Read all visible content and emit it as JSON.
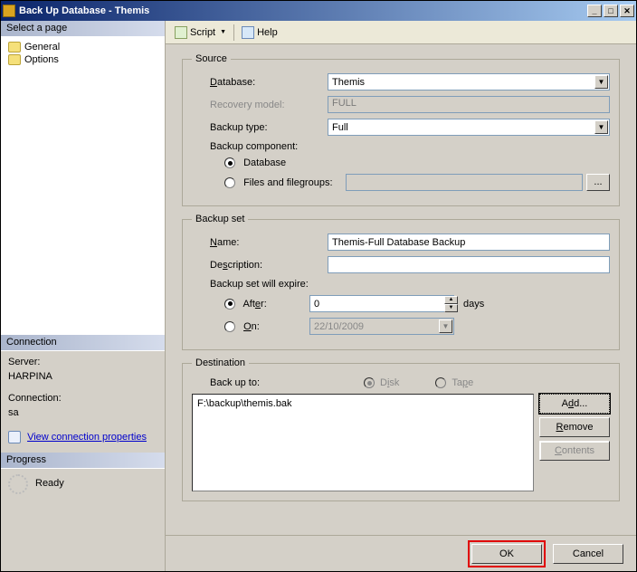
{
  "title": "Back Up Database - Themis",
  "leftpane": {
    "select_page_hdr": "Select a page",
    "nav": [
      "General",
      "Options"
    ],
    "connection_hdr": "Connection",
    "server_label": "Server:",
    "server_value": "HARPINA",
    "connection_label": "Connection:",
    "connection_value": "sa",
    "view_props": "View connection properties",
    "progress_hdr": "Progress",
    "progress_text": "Ready"
  },
  "toolbar": {
    "script": "Script",
    "help": "Help"
  },
  "source": {
    "legend": "Source",
    "database_label": "Database:",
    "database_value": "Themis",
    "recovery_label": "Recovery model:",
    "recovery_value": "FULL",
    "backuptype_label": "Backup type:",
    "backuptype_value": "Full",
    "component_label": "Backup component:",
    "opt_database": "Database",
    "opt_files": "Files and filegroups:",
    "files_btn": "..."
  },
  "backupset": {
    "legend": "Backup set",
    "name_label": "Name:",
    "name_value": "Themis-Full Database Backup",
    "desc_label": "Description:",
    "desc_value": "",
    "expire_label": "Backup set will expire:",
    "after_label": "After:",
    "after_value": "0",
    "after_unit": "days",
    "on_label": "On:",
    "on_value": "22/10/2009"
  },
  "dest": {
    "legend": "Destination",
    "backup_to": "Back up to:",
    "opt_disk": "Disk",
    "opt_tape": "Tape",
    "path": "F:\\backup\\themis.bak",
    "add": "Add...",
    "remove": "Remove",
    "contents": "Contents"
  },
  "footer": {
    "ok": "OK",
    "cancel": "Cancel"
  }
}
